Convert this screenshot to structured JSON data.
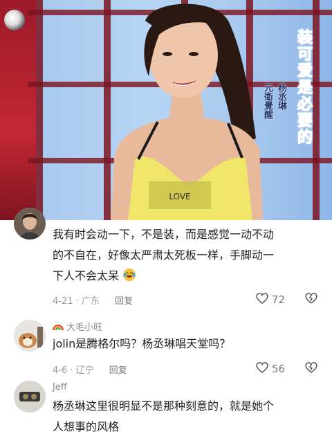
{
  "video": {
    "caption_title": "装可爱是必要的",
    "caption_name": "杨丞琳",
    "caption_sub": "元衛覺醒",
    "shirt_text": "LOVE"
  },
  "comments": [
    {
      "username": "",
      "text_line1": "我有时会动一下，不是装，而是感觉一动不动",
      "text_line2": "的不自在，好像太严肃太死板一样，手脚动一",
      "text_line3": "下人不会太呆",
      "emoji": "laughing-crying-emoji",
      "date_location": "4-21 · 广东",
      "reply_label": "回复",
      "likes": "72"
    },
    {
      "username": "大毛小旺",
      "username_badge": "rainbow-icon",
      "text_line1": "jolin是腾格尔吗？杨丞琳唱天堂吗？",
      "date_location": "4-6 · 辽宁",
      "reply_label": "回复",
      "likes": "56"
    },
    {
      "username": "Jeff",
      "text_line1": "杨丞琳这里很明显不是那种刻意的，就是她个",
      "text_line2": "人想事的风格"
    }
  ],
  "colors": {
    "caption_title": "#c0289b",
    "caption_name": "#2a3c6e",
    "meta": "#9a9a9a",
    "background": "#ffffff"
  }
}
